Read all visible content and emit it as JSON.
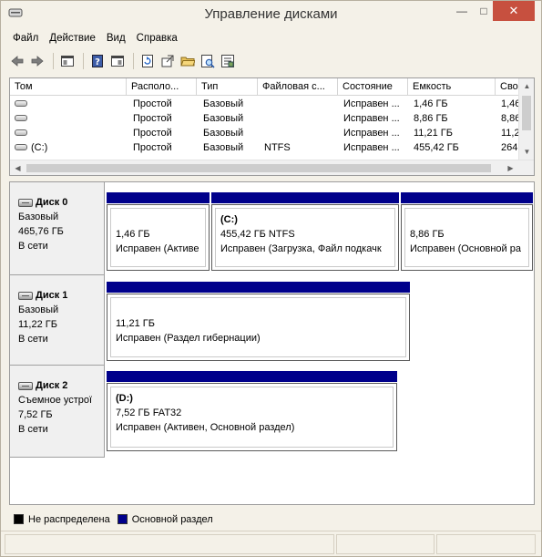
{
  "window": {
    "title": "Управление дисками"
  },
  "menu": [
    "Файл",
    "Действие",
    "Вид",
    "Справка"
  ],
  "toolbar": {
    "icons": [
      "back-arrow-icon",
      "forward-arrow-icon",
      "properties-panel-icon",
      "help-icon",
      "details-panel-icon",
      "refresh-icon",
      "export-icon",
      "open-folder-icon",
      "search-disk-icon",
      "settings-list-icon"
    ]
  },
  "volume_table": {
    "columns": [
      "Том",
      "Располо...",
      "Тип",
      "Файловая с...",
      "Состояние",
      "Емкость",
      "Сво"
    ],
    "rows": [
      {
        "volume": "",
        "layout": "Простой",
        "type": "Базовый",
        "fs": "",
        "status": "Исправен ...",
        "capacity": "1,46 ГБ",
        "free": "1,46"
      },
      {
        "volume": "",
        "layout": "Простой",
        "type": "Базовый",
        "fs": "",
        "status": "Исправен ...",
        "capacity": "8,86 ГБ",
        "free": "8,86"
      },
      {
        "volume": "",
        "layout": "Простой",
        "type": "Базовый",
        "fs": "",
        "status": "Исправен ...",
        "capacity": "11,21 ГБ",
        "free": "11,2"
      },
      {
        "volume": "(C:)",
        "layout": "Простой",
        "type": "Базовый",
        "fs": "NTFS",
        "status": "Исправен ...",
        "capacity": "455,42 ГБ",
        "free": "264,"
      }
    ]
  },
  "disks": [
    {
      "name": "Диск 0",
      "type": "Базовый",
      "size": "465,76 ГБ",
      "state": "В сети",
      "partitions": [
        {
          "vol": "",
          "size": "1,46 ГБ",
          "status": "Исправен (Активе"
        },
        {
          "vol": "(C:)",
          "size": "455,42 ГБ NTFS",
          "status": "Исправен (Загрузка, Файл подкачк"
        },
        {
          "vol": "",
          "size": "8,86 ГБ",
          "status": "Исправен (Основной ра"
        }
      ]
    },
    {
      "name": "Диск 1",
      "type": "Базовый",
      "size": "11,22 ГБ",
      "state": "В сети",
      "partitions": [
        {
          "vol": "",
          "size": "11,21 ГБ",
          "status": "Исправен (Раздел гибернации)"
        }
      ]
    },
    {
      "name": "Диск 2",
      "type": "Съемное устрої",
      "size": "7,52 ГБ",
      "state": "В сети",
      "partitions": [
        {
          "vol": "(D:)",
          "size": "7,52 ГБ FAT32",
          "status": "Исправен (Активен, Основной раздел)"
        }
      ]
    }
  ],
  "legend": [
    {
      "label": "Не распределена",
      "color": "#000000"
    },
    {
      "label": "Основной раздел",
      "color": "#00008b"
    }
  ],
  "colors": {
    "primary_partition": "#00008b",
    "unallocated": "#000000",
    "close_button": "#c7503f"
  }
}
